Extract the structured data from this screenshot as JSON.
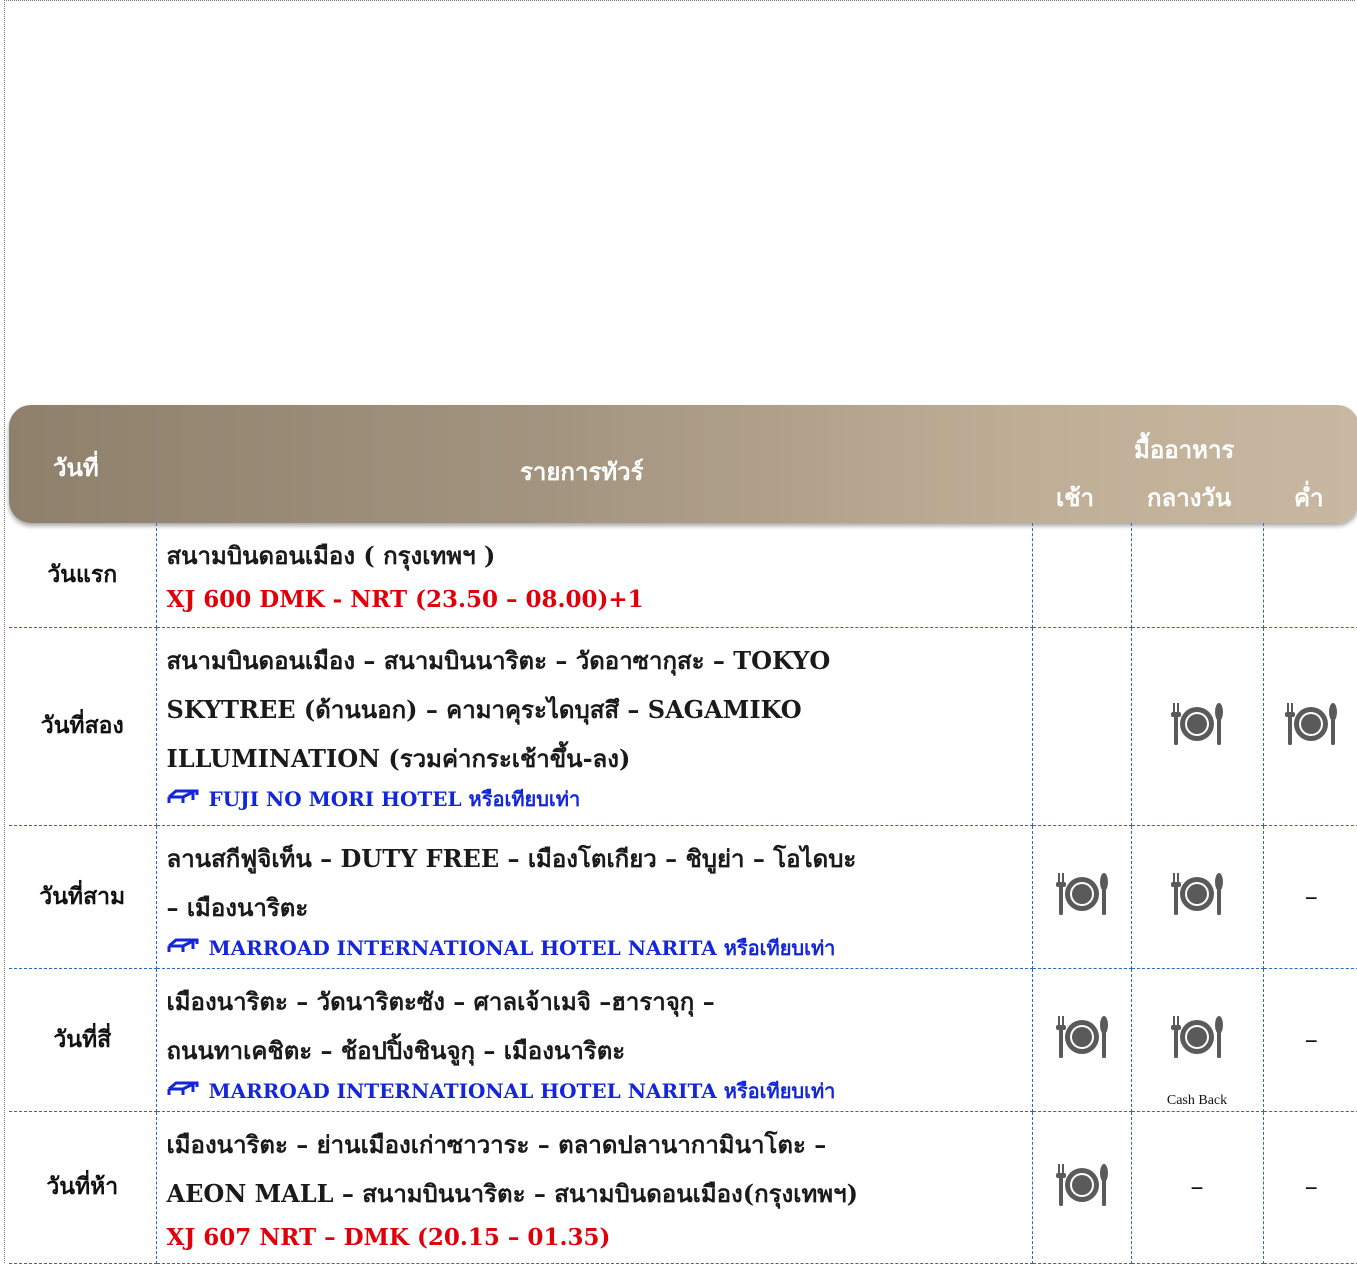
{
  "header": {
    "day_col": "วันที่",
    "program_col": "รายการทัวร์",
    "meals_col": "มื้ออาหาร",
    "breakfast": "เช้า",
    "lunch": "กลางวัน",
    "dinner": "ค่ำ"
  },
  "rows": [
    {
      "day": "วันแรก",
      "lines": [
        "สนามบินดอนเมือง ( กรุงเทพฯ )"
      ],
      "flight": "XJ 600  DMK - NRT  (23.50 – 08.00)+1",
      "hotel": "",
      "breakfast": "",
      "lunch": "",
      "dinner": ""
    },
    {
      "day": "วันที่สอง",
      "lines": [
        "สนามบินดอนเมือง – สนามบินนาริตะ – วัดอาซากุสะ – TOKYO",
        "SKYTREE (ด้านนอก) – คามาคุระไดบุสสึ – SAGAMIKO",
        "ILLUMINATION (รวมค่ากระเช้าขึ้น-ลง)"
      ],
      "flight": "",
      "hotel": "FUJI  NO MORI HOTEL หรือเทียบเท่า",
      "breakfast": "",
      "lunch": "meal-icon",
      "dinner": "meal-icon"
    },
    {
      "day": "วันที่สาม",
      "lines": [
        "ลานสกีฟูจิเท็น – DUTY FREE – เมืองโตเกียว – ชิบูย่า – โอไดบะ",
        "– เมืองนาริตะ"
      ],
      "flight": "",
      "hotel": "MARROAD INTERNATIONAL HOTEL NARITA หรือเทียบเท่า",
      "breakfast": "meal-icon",
      "lunch": "meal-icon",
      "dinner": "–"
    },
    {
      "day": "วันที่สี่",
      "lines": [
        "เมืองนาริตะ – วัดนาริตะซัง – ศาลเจ้าเมจิ –ฮาราจุกุ –",
        "ถนนทาเคชิตะ – ช้อปปิ้งชินจูกุ – เมืองนาริตะ"
      ],
      "flight": "",
      "hotel": "MARROAD INTERNATIONAL HOTEL NARITA หรือเทียบเท่า",
      "breakfast": "meal-icon",
      "lunch": "meal-icon",
      "lunch_note": "Cash Back",
      "dinner": "–"
    },
    {
      "day": "วันที่ห้า",
      "lines": [
        "เมืองนาริตะ – ย่านเมืองเก่าซาวาระ – ตลาดปลานากามินาโตะ –",
        "AEON MALL – สนามบินนาริตะ – สนามบินดอนเมือง(กรุงเทพฯ)"
      ],
      "flight": "XJ 607  NRT – DMK  (20.15 – 01.35)",
      "hotel": "",
      "breakfast": "meal-icon",
      "lunch": "–",
      "dinner": "–"
    }
  ]
}
